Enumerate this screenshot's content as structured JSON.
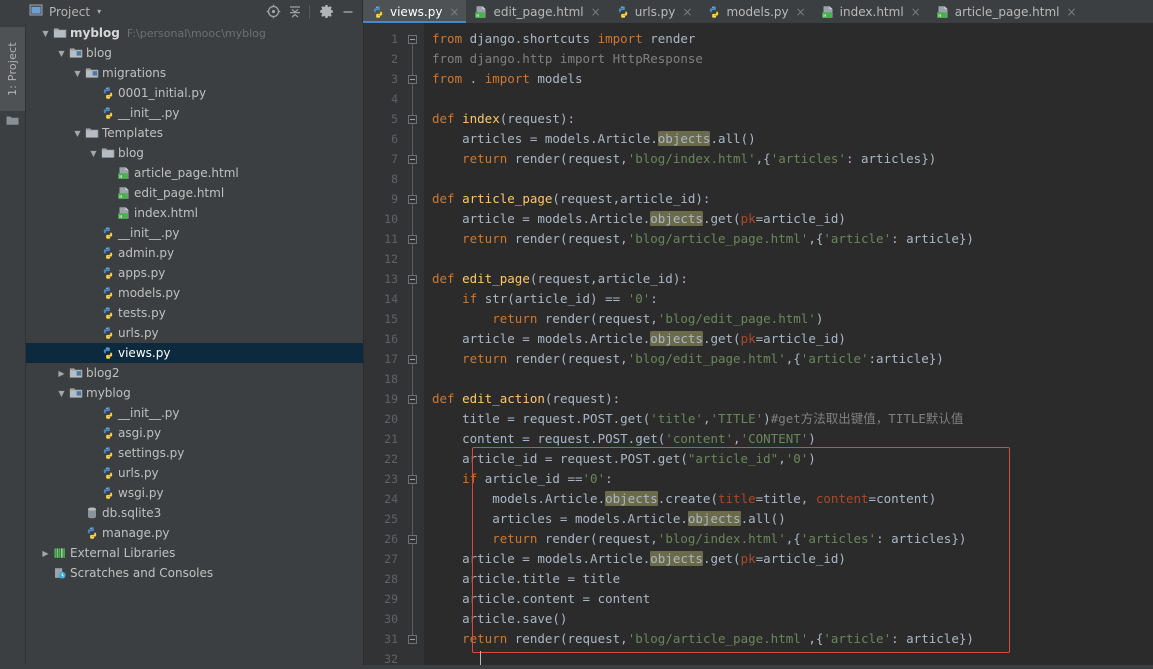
{
  "window": {
    "theme_bg": "#3c3f41",
    "editor_bg": "#2b2b2b",
    "accent": "#4a88c7",
    "selection": "#0d293e",
    "highlight": "#6b6b4a",
    "redbox": "#e0463c"
  },
  "left_strip": {
    "label": "1: Project",
    "icon": "folder-icon"
  },
  "project_panel": {
    "title": "Project",
    "dropdown_caret": "▾",
    "icon": "project-view-icon",
    "toolbar": [
      {
        "name": "locate-icon",
        "glyph": "target"
      },
      {
        "name": "collapse-all-icon",
        "glyph": "collapse"
      },
      {
        "name": "settings-gear-icon",
        "glyph": "gear"
      },
      {
        "name": "hide-panel-icon",
        "glyph": "minus"
      }
    ],
    "tree": [
      {
        "indent": 0,
        "arrow": "▼",
        "icon": "folder-icon",
        "label": "myblog",
        "bold": true,
        "path": "F:\\personal\\mooc\\myblog",
        "selected": false
      },
      {
        "indent": 1,
        "arrow": "▼",
        "icon": "module-icon",
        "label": "blog",
        "bold": false,
        "path": "",
        "selected": false
      },
      {
        "indent": 2,
        "arrow": "▼",
        "icon": "module-icon",
        "label": "migrations",
        "bold": false,
        "path": "",
        "selected": false
      },
      {
        "indent": 3,
        "arrow": "",
        "icon": "python-file-icon",
        "label": "0001_initial.py",
        "bold": false,
        "path": "",
        "selected": false
      },
      {
        "indent": 3,
        "arrow": "",
        "icon": "python-file-icon",
        "label": "__init__.py",
        "bold": false,
        "path": "",
        "selected": false
      },
      {
        "indent": 2,
        "arrow": "▼",
        "icon": "folder-icon",
        "label": "Templates",
        "bold": false,
        "path": "",
        "selected": false
      },
      {
        "indent": 3,
        "arrow": "▼",
        "icon": "folder-icon",
        "label": "blog",
        "bold": false,
        "path": "",
        "selected": false
      },
      {
        "indent": 4,
        "arrow": "",
        "icon": "html-file-icon",
        "label": "article_page.html",
        "bold": false,
        "path": "",
        "selected": false
      },
      {
        "indent": 4,
        "arrow": "",
        "icon": "html-file-icon",
        "label": "edit_page.html",
        "bold": false,
        "path": "",
        "selected": false
      },
      {
        "indent": 4,
        "arrow": "",
        "icon": "html-file-icon",
        "label": "index.html",
        "bold": false,
        "path": "",
        "selected": false
      },
      {
        "indent": 3,
        "arrow": "",
        "icon": "python-file-icon",
        "label": "__init__.py",
        "bold": false,
        "path": "",
        "selected": false
      },
      {
        "indent": 3,
        "arrow": "",
        "icon": "python-file-icon",
        "label": "admin.py",
        "bold": false,
        "path": "",
        "selected": false
      },
      {
        "indent": 3,
        "arrow": "",
        "icon": "python-file-icon",
        "label": "apps.py",
        "bold": false,
        "path": "",
        "selected": false
      },
      {
        "indent": 3,
        "arrow": "",
        "icon": "python-file-icon",
        "label": "models.py",
        "bold": false,
        "path": "",
        "selected": false
      },
      {
        "indent": 3,
        "arrow": "",
        "icon": "python-file-icon",
        "label": "tests.py",
        "bold": false,
        "path": "",
        "selected": false
      },
      {
        "indent": 3,
        "arrow": "",
        "icon": "python-file-icon",
        "label": "urls.py",
        "bold": false,
        "path": "",
        "selected": false
      },
      {
        "indent": 3,
        "arrow": "",
        "icon": "python-file-icon",
        "label": "views.py",
        "bold": false,
        "path": "",
        "selected": true
      },
      {
        "indent": 1,
        "arrow": "▶",
        "icon": "module-icon",
        "label": "blog2",
        "bold": false,
        "path": "",
        "selected": false
      },
      {
        "indent": 1,
        "arrow": "▼",
        "icon": "module-icon",
        "label": "myblog",
        "bold": false,
        "path": "",
        "selected": false
      },
      {
        "indent": 3,
        "arrow": "",
        "icon": "python-file-icon",
        "label": "__init__.py",
        "bold": false,
        "path": "",
        "selected": false
      },
      {
        "indent": 3,
        "arrow": "",
        "icon": "python-file-icon",
        "label": "asgi.py",
        "bold": false,
        "path": "",
        "selected": false
      },
      {
        "indent": 3,
        "arrow": "",
        "icon": "python-file-icon",
        "label": "settings.py",
        "bold": false,
        "path": "",
        "selected": false
      },
      {
        "indent": 3,
        "arrow": "",
        "icon": "python-file-icon",
        "label": "urls.py",
        "bold": false,
        "path": "",
        "selected": false
      },
      {
        "indent": 3,
        "arrow": "",
        "icon": "python-file-icon",
        "label": "wsgi.py",
        "bold": false,
        "path": "",
        "selected": false
      },
      {
        "indent": 2,
        "arrow": "",
        "icon": "database-file-icon",
        "label": "db.sqlite3",
        "bold": false,
        "path": "",
        "selected": false
      },
      {
        "indent": 2,
        "arrow": "",
        "icon": "python-file-icon",
        "label": "manage.py",
        "bold": false,
        "path": "",
        "selected": false
      },
      {
        "indent": 0,
        "arrow": "▶",
        "icon": "libraries-icon",
        "label": "External Libraries",
        "bold": false,
        "path": "",
        "selected": false
      },
      {
        "indent": 0,
        "arrow": "",
        "icon": "scratches-icon",
        "label": "Scratches and Consoles",
        "bold": false,
        "path": "",
        "selected": false
      }
    ]
  },
  "editor_tabs": [
    {
      "label": "views.py",
      "icon": "python-file-icon",
      "active": true,
      "close": "×"
    },
    {
      "label": "edit_page.html",
      "icon": "html-file-icon",
      "active": false,
      "close": "×"
    },
    {
      "label": "urls.py",
      "icon": "python-file-icon",
      "active": false,
      "close": "×"
    },
    {
      "label": "models.py",
      "icon": "python-file-icon",
      "active": false,
      "close": "×"
    },
    {
      "label": "index.html",
      "icon": "html-file-icon",
      "active": false,
      "close": "×"
    },
    {
      "label": "article_page.html",
      "icon": "html-file-icon",
      "active": false,
      "close": "×"
    }
  ],
  "editor": {
    "filename": "views.py",
    "first_line": 1,
    "last_line": 32,
    "line_numbers": [
      "1",
      "2",
      "3",
      "4",
      "5",
      "6",
      "7",
      "8",
      "9",
      "10",
      "11",
      "12",
      "13",
      "14",
      "15",
      "16",
      "17",
      "18",
      "19",
      "20",
      "21",
      "22",
      "23",
      "24",
      "25",
      "26",
      "27",
      "28",
      "29",
      "30",
      "31",
      "32"
    ],
    "fold_lines": [
      1,
      3,
      5,
      7,
      9,
      11,
      13,
      17,
      19,
      23,
      26,
      31
    ],
    "annotation_box": {
      "from_line": 22,
      "to_line": 31,
      "color": "#e0463c"
    },
    "caret_line": 32,
    "code_lines": [
      {
        "n": 1,
        "text": "from django.shortcuts import render"
      },
      {
        "n": 2,
        "text": "from django.http import HttpResponse"
      },
      {
        "n": 3,
        "text": "from . import models"
      },
      {
        "n": 4,
        "text": ""
      },
      {
        "n": 5,
        "text": "def index(request):"
      },
      {
        "n": 6,
        "text": "    articles = models.Article.objects.all()"
      },
      {
        "n": 7,
        "text": "    return render(request,'blog/index.html',{'articles': articles})"
      },
      {
        "n": 8,
        "text": ""
      },
      {
        "n": 9,
        "text": "def article_page(request,article_id):"
      },
      {
        "n": 10,
        "text": "    article = models.Article.objects.get(pk=article_id)"
      },
      {
        "n": 11,
        "text": "    return render(request,'blog/article_page.html',{'article': article})"
      },
      {
        "n": 12,
        "text": ""
      },
      {
        "n": 13,
        "text": "def edit_page(request,article_id):"
      },
      {
        "n": 14,
        "text": "    if str(article_id) == '0':"
      },
      {
        "n": 15,
        "text": "        return render(request,'blog/edit_page.html')"
      },
      {
        "n": 16,
        "text": "    article = models.Article.objects.get(pk=article_id)"
      },
      {
        "n": 17,
        "text": "    return render(request,'blog/edit_page.html',{'article':article})"
      },
      {
        "n": 18,
        "text": ""
      },
      {
        "n": 19,
        "text": "def edit_action(request):"
      },
      {
        "n": 20,
        "text": "    title = request.POST.get('title','TITLE')#get方法取出键值，TITLE默认值"
      },
      {
        "n": 21,
        "text": "    content = request.POST.get('content','CONTENT')"
      },
      {
        "n": 22,
        "text": "    article_id = request.POST.get(\"article_id\",'0')"
      },
      {
        "n": 23,
        "text": "    if article_id =='0':"
      },
      {
        "n": 24,
        "text": "        models.Article.objects.create(title=title, content=content)"
      },
      {
        "n": 25,
        "text": "        articles = models.Article.objects.all()"
      },
      {
        "n": 26,
        "text": "        return render(request,'blog/index.html',{'articles': articles})"
      },
      {
        "n": 27,
        "text": "    article = models.Article.objects.get(pk=article_id)"
      },
      {
        "n": 28,
        "text": "    article.title = title"
      },
      {
        "n": 29,
        "text": "    article.content = content"
      },
      {
        "n": 30,
        "text": "    article.save()"
      },
      {
        "n": 31,
        "text": "    return render(request,'blog/article_page.html',{'article': article})"
      },
      {
        "n": 32,
        "text": ""
      }
    ]
  }
}
